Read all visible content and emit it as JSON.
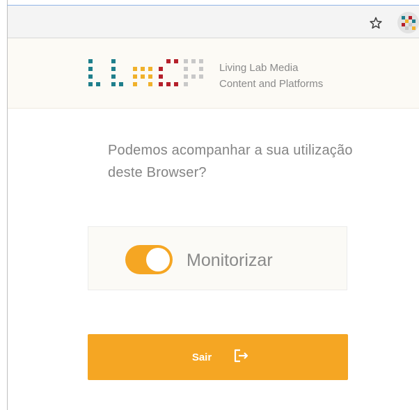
{
  "browser": {
    "bookmark_icon": "star-icon",
    "extension_icon": "lab-extension-icon"
  },
  "header": {
    "logo_letters": "LLMCP",
    "org_line1": "Living Lab Media",
    "org_line2": "Content and Platforms"
  },
  "main": {
    "question": "Podemos acompanhar a sua utilização deste Browser?",
    "toggle": {
      "label": "Monitorizar",
      "checked": true
    },
    "exit": {
      "label": "Sair",
      "icon": "sign-out-icon"
    }
  },
  "colors": {
    "accent": "#f5a623",
    "logo_teal": "#1f7f8c",
    "logo_yellow": "#f0b12b",
    "logo_red": "#b5202b",
    "logo_gray": "#c8c8c8",
    "text_gray": "#848484"
  }
}
